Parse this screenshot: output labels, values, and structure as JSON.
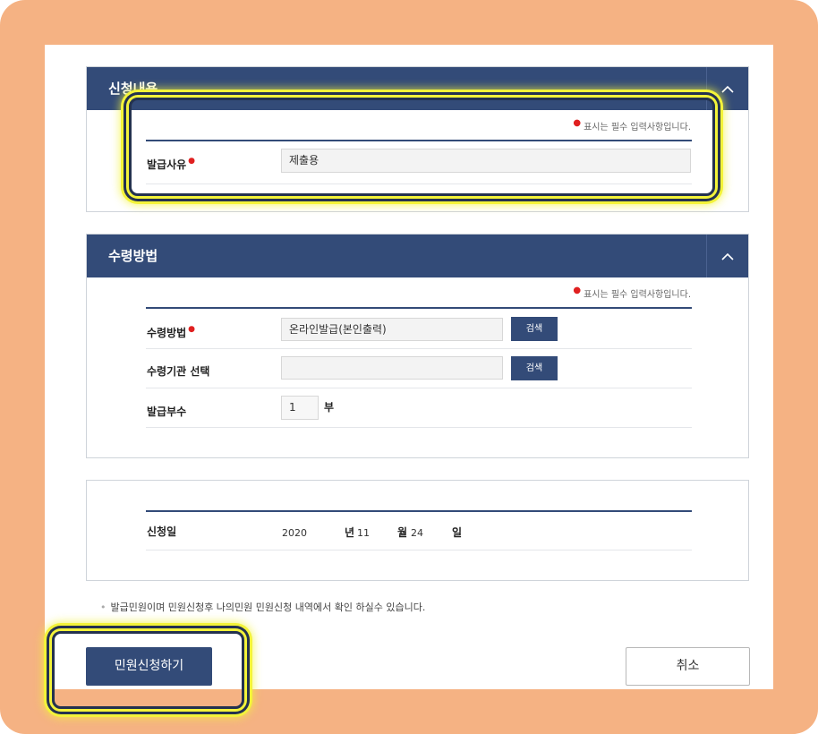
{
  "required_note": "표시는 필수 입력사항입니다.",
  "section1": {
    "title": "신청내용",
    "fields": {
      "reason_label": "발급사유",
      "reason_value": "제출용"
    }
  },
  "section2": {
    "title": "수령방법",
    "fields": {
      "method_label": "수령방법",
      "method_value": "온라인발급(본인출력)",
      "agency_label": "수령기관 선택",
      "agency_value": "",
      "copies_label": "발급부수",
      "copies_value": "1",
      "copies_unit": "부",
      "search_label": "검색"
    }
  },
  "section3": {
    "date_label": "신청일",
    "year": "2020",
    "year_unit": "년",
    "month": "11",
    "month_unit": "월",
    "day": "24",
    "day_unit": "일"
  },
  "footnote": "발급민원이며 민원신청후 나의민원 민원신청 내역에서 확인 하실수 있습니다.",
  "buttons": {
    "submit": "민원신청하기",
    "cancel": "취소"
  },
  "colors": {
    "header_bg": "#334b78",
    "highlight": "#f3f33a",
    "frame": "#f5b283"
  }
}
